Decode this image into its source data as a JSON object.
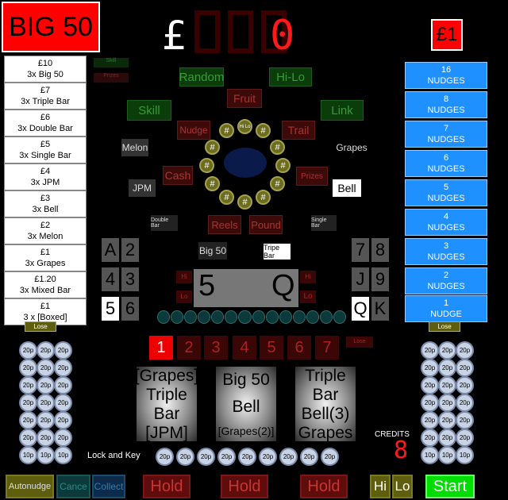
{
  "header": {
    "title": "BIG 50",
    "currency_symbol": "£",
    "display_digit": "0",
    "stake": "£1"
  },
  "paytable": [
    {
      "amount": "£10",
      "label": "3x Big 50"
    },
    {
      "amount": "£7",
      "label": "3x Triple Bar"
    },
    {
      "amount": "£6",
      "label": "3x Double Bar"
    },
    {
      "amount": "£5",
      "label": "3x Single Bar"
    },
    {
      "amount": "£4",
      "label": "3x JPM"
    },
    {
      "amount": "£3",
      "label": "3x Bell"
    },
    {
      "amount": "£2",
      "label": "3x Melon"
    },
    {
      "amount": "£1",
      "label": "3x Grapes"
    },
    {
      "amount": "£1.20",
      "label": "3x Mixed Bar"
    },
    {
      "amount": "£1",
      "label": "3 x [Boxed]"
    }
  ],
  "nudges": [
    {
      "count": "16",
      "label": "NUDGES"
    },
    {
      "count": "8",
      "label": "NUDGES"
    },
    {
      "count": "7",
      "label": "NUDGES"
    },
    {
      "count": "6",
      "label": "NUDGES"
    },
    {
      "count": "5",
      "label": "NUDGES"
    },
    {
      "count": "4",
      "label": "NUDGES"
    },
    {
      "count": "3",
      "label": "NUDGES"
    },
    {
      "count": "2",
      "label": "NUDGES"
    },
    {
      "count": "1",
      "label": "NUDGE"
    }
  ],
  "features": {
    "random": "Random",
    "hilo": "Hi-Lo",
    "fruit": "Fruit",
    "skill": "Skill",
    "link": "Link",
    "nudge": "Nudge",
    "trail": "Trail",
    "melon": "Melon",
    "grapes": "Grapes",
    "cash": "Cash",
    "prizes": "Prizes",
    "jpm": "JPM",
    "bell": "Bell",
    "double_bar": "Double Bar",
    "reels": "Reels",
    "pound": "Pound",
    "single_bar": "Single Bar",
    "big50": "Big 50",
    "triple_bar": "Tripe Bar"
  },
  "trail_symbol": "#",
  "trail_top": "Hi Lo",
  "cards_left": [
    [
      "A",
      "2"
    ],
    [
      "4",
      "3"
    ],
    [
      "5",
      "6"
    ]
  ],
  "cards_right": [
    [
      "7",
      "8"
    ],
    [
      "J",
      "9"
    ],
    [
      "Q",
      "K"
    ]
  ],
  "hilo_display": {
    "left": "5",
    "right": "Q"
  },
  "lose_label": "Lose",
  "hilo_side": {
    "hi": "Hi",
    "lo": "Lo"
  },
  "number_trail": [
    "1",
    "2",
    "3",
    "4",
    "5",
    "6",
    "7"
  ],
  "reels": [
    [
      "[Grapes]",
      "Triple Bar",
      "[JPM]"
    ],
    [
      "Big 50",
      "Bell",
      "[Grapes(2)]"
    ],
    [
      "Triple Bar",
      "Bell(3)",
      "Grapes"
    ]
  ],
  "coin_label": "20p",
  "coin_label_10": "10p",
  "credits": {
    "label": "CREDITS",
    "value": "8"
  },
  "lock_key": "Lock and Key",
  "buttons": {
    "autonudge": "Autonudge",
    "cancel": "Cance",
    "collect": "Collect",
    "hold1": "Hold",
    "hold2": "Hold",
    "hold3": "Hold",
    "hi": "Hi",
    "lo": "Lo",
    "start": "Start"
  }
}
